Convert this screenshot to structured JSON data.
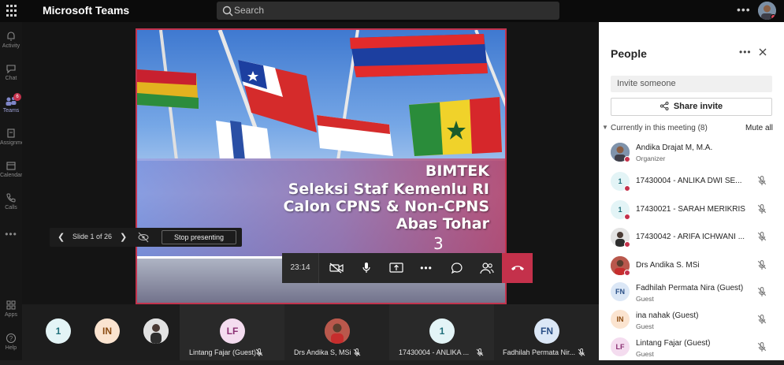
{
  "app": {
    "title": "Microsoft Teams"
  },
  "search": {
    "placeholder": "Search"
  },
  "rail": [
    {
      "label": "Activity",
      "icon": "bell-icon"
    },
    {
      "label": "Chat",
      "icon": "chat-icon"
    },
    {
      "label": "Teams",
      "icon": "teams-icon",
      "badge": "6"
    },
    {
      "label": "Assignments",
      "icon": "assignments-icon"
    },
    {
      "label": "Calendar",
      "icon": "calendar-icon"
    },
    {
      "label": "Calls",
      "icon": "phone-icon"
    },
    {
      "label": "Apps",
      "icon": "apps-icon"
    },
    {
      "label": "Help",
      "icon": "help-icon"
    }
  ],
  "slide": {
    "line1": "BIMTEK",
    "line2": "Seleksi Staf Kemenlu RI",
    "line3": "Calon CPNS & Non-CPNS",
    "line4": "Abas Tohar",
    "number": "3"
  },
  "slide_controls": {
    "label": "Slide 1 of 26",
    "stop_label": "Stop presenting"
  },
  "call_controls": {
    "time": "23:14",
    "hangup_color": "#c4314b"
  },
  "gallery": [
    {
      "initials": "1",
      "name": ""
    },
    {
      "initials": "IN",
      "name": ""
    },
    {
      "initials": "",
      "name": ""
    },
    {
      "initials": "LF",
      "name": "Lintang Fajar (Guest)"
    },
    {
      "initials": "",
      "name": "Drs Andika S, MSi"
    },
    {
      "initials": "1",
      "name": "17430004 - ANLIKA ..."
    },
    {
      "initials": "FN",
      "name": "Fadhilah Permata Nir..."
    }
  ],
  "people": {
    "title": "People",
    "invite_placeholder": "Invite someone",
    "share_invite": "Share invite",
    "section_label": "Currently in this meeting (8)",
    "mute_all": "Mute all",
    "participants": [
      {
        "initials": "",
        "name": "Andika Drajat M, M.A.",
        "sub": "Organizer"
      },
      {
        "initials": "1",
        "name": "17430004 - ANLIKA DWI SE...",
        "sub": ""
      },
      {
        "initials": "1",
        "name": "17430021 - SARAH MERIKRIS",
        "sub": ""
      },
      {
        "initials": "",
        "name": "17430042 - ARIFA ICHWANI ...",
        "sub": ""
      },
      {
        "initials": "",
        "name": "Drs Andika S. MSi",
        "sub": ""
      },
      {
        "initials": "FN",
        "name": "Fadhilah Permata Nira (Guest)",
        "sub": "Guest"
      },
      {
        "initials": "IN",
        "name": "ina nahak (Guest)",
        "sub": "Guest"
      },
      {
        "initials": "LF",
        "name": "Lintang Fajar (Guest)",
        "sub": "Guest"
      }
    ]
  }
}
